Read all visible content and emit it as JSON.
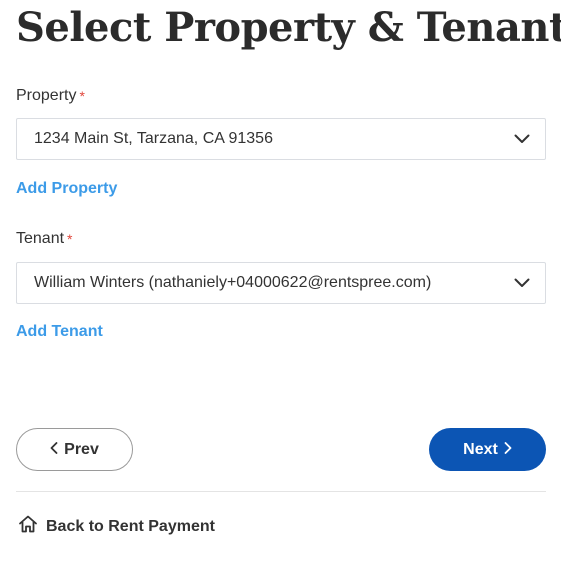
{
  "page": {
    "title": "Select Property & Tenant"
  },
  "property": {
    "label": "Property",
    "required_mark": "*",
    "selected": "1234 Main St, Tarzana, CA 91356",
    "add_link": "Add Property"
  },
  "tenant": {
    "label": "Tenant",
    "required_mark": "*",
    "selected": "William Winters (nathaniely+04000622@rentspree.com)",
    "add_link": "Add Tenant"
  },
  "nav": {
    "prev_label": "Prev",
    "next_label": "Next",
    "back_label": "Back to Rent Payment"
  },
  "icons": {
    "select_chevron": "chevron-down-icon",
    "prev": "chevron-left-icon",
    "next": "chevron-right-icon",
    "back": "home-icon"
  },
  "colors": {
    "link": "#3c9be8",
    "primary_button": "#0c55b4",
    "required": "#e0453a",
    "border": "#dadde2"
  }
}
